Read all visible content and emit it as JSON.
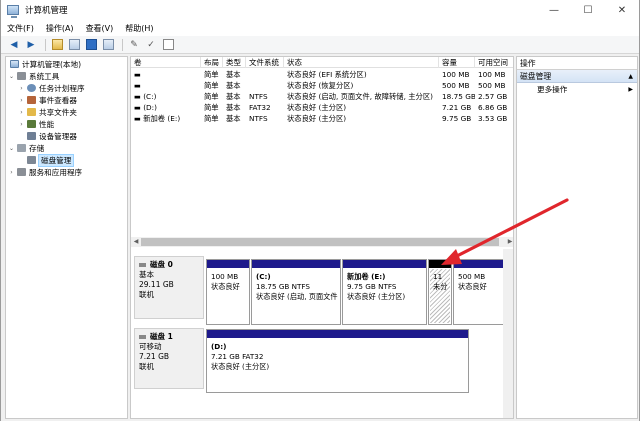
{
  "window": {
    "title": "计算机管理",
    "minimize": "—",
    "maximize": "☐",
    "close": "✕"
  },
  "menu": [
    "文件(F)",
    "操作(A)",
    "查看(V)",
    "帮助(H)"
  ],
  "tree": {
    "root": "计算机管理(本地)",
    "system_tools": "系统工具",
    "task_scheduler": "任务计划程序",
    "event_viewer": "事件查看器",
    "shared_folders": "共享文件夹",
    "performance": "性能",
    "device_manager": "设备管理器",
    "storage": "存储",
    "disk_management": "磁盘管理",
    "services": "服务和应用程序"
  },
  "volumes": {
    "headers": [
      "卷",
      "布局",
      "类型",
      "文件系统",
      "状态",
      "容量",
      "可用空间"
    ],
    "rows": [
      [
        "▬",
        "简单",
        "基本",
        "",
        "状态良好 (EFI 系统分区)",
        "100 MB",
        "100 MB"
      ],
      [
        "▬",
        "简单",
        "基本",
        "",
        "状态良好 (恢复分区)",
        "500 MB",
        "500 MB"
      ],
      [
        "▬ (C:)",
        "简单",
        "基本",
        "NTFS",
        "状态良好 (启动, 页面文件, 故障转储, 主分区)",
        "18.75 GB",
        "2.57 GB"
      ],
      [
        "▬ (D:)",
        "简单",
        "基本",
        "FAT32",
        "状态良好 (主分区)",
        "7.21 GB",
        "6.86 GB"
      ],
      [
        "▬ 新加卷 (E:)",
        "简单",
        "基本",
        "NTFS",
        "状态良好 (主分区)",
        "9.75 GB",
        "3.53 GB"
      ]
    ]
  },
  "disk0": {
    "name": "磁盘 0",
    "type": "基本",
    "size": "29.11 GB",
    "status": "联机",
    "partitions": [
      {
        "name": "",
        "size": "100 MB",
        "state": "状态良好"
      },
      {
        "name": "(C:)",
        "size": "18.75 GB NTFS",
        "state": "状态良好 (启动, 页面文件"
      },
      {
        "name": "新加卷 (E:)",
        "size": "9.75 GB NTFS",
        "state": "状态良好 (主分区)"
      },
      {
        "name": "",
        "size": "11",
        "state": "未分"
      },
      {
        "name": "",
        "size": "500 MB",
        "state": "状态良好"
      }
    ]
  },
  "disk1": {
    "name": "磁盘 1",
    "type": "可移动",
    "size": "7.21 GB",
    "status": "联机",
    "partition": {
      "name": "(D:)",
      "size": "7.21 GB FAT32",
      "state": "状态良好 (主分区)"
    }
  },
  "actions": {
    "header": "操作",
    "section": "磁盘管理",
    "more": "更多操作",
    "section_arrow": "▲",
    "more_arrow": "▶"
  },
  "colors": {
    "primary_partition": "#1e1a8c",
    "unallocated": "#000000",
    "arrow": "#e0262c",
    "selection": "#cce8ff"
  }
}
